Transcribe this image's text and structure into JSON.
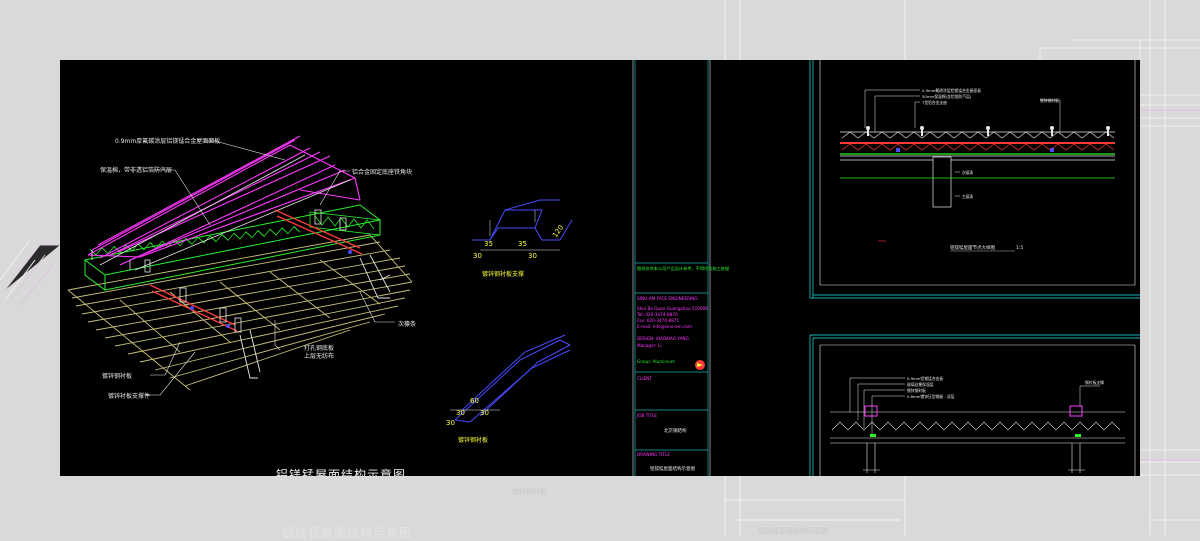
{
  "iso_view": {
    "labels": {
      "panel": "0.9mm厚氟碳涂层铝镁锰合金屋面面板",
      "insulation": "保温棉，带非透铝箔防汽层",
      "bracket": "铝合金固定底座铁角块",
      "purlin": "次檩条",
      "ribbed": "打孔钢底板",
      "upper_layer": "上层无纺布",
      "galv": "镀锌钢衬板",
      "galv_support": "镀锌衬板支撑件"
    },
    "caption": "铝镁锰屋面结构示意图"
  },
  "profile_a": {
    "label": "镀锌钢衬板支撑",
    "dims": [
      "35",
      "35",
      "30",
      "30",
      "120"
    ]
  },
  "profile_b": {
    "label": "镀锌钢衬板",
    "dims": [
      "60",
      "30",
      "30",
      "30"
    ]
  },
  "title_block": {
    "note_top": "图纸仅供本公司产品设计参考，不得作为施工依据",
    "company_en": "SINO-AM FACE ENGINEERING",
    "addr_lines": [
      "Shui Ba Quan Guangzhou 510006",
      "Tel: 020-3474-8870",
      "Fax: 020-3474-8871",
      "E-mail: info@sino-am.com"
    ],
    "mgr_lines": [
      "DESIGN: XIAOXIAO YANG",
      "Manager: Li"
    ],
    "group_name": "Group: Aluminium",
    "client_label": "CLIENT",
    "job_title_label": "JOB TITLE",
    "job_title_value": "北京钢结构",
    "drawing_title_label": "DRAWING TITLE",
    "drawing_title_value": "铝镁锰屋面结构示意图"
  },
  "section_top": {
    "caption": "铝镁锰屋面节点大样图",
    "scale": "1:5",
    "callouts": [
      "0.9mm氟碳涂层铝镁锰合金屋面板",
      "50mm保温棉(含铝箔防汽层)",
      "T型铝合金支座",
      "镀锌钢衬板",
      "次檩条",
      "主檩条"
    ]
  },
  "section_bottom": {
    "callouts": [
      "0.9mm铝镁锰合金板",
      "玻璃丝棉保温层",
      "镀锌钢衬板",
      "钢衬板支撑",
      "0.6mm镀锌压型钢板 - 双层"
    ]
  },
  "ghost": {
    "caption_left": "铝镁锰屋面结构示意图",
    "caption_mid": "镀锌钢衬板",
    "caption_right": "铝镁锰屋面结构示意图"
  },
  "colors": {
    "canvas": "#000000",
    "magenta": "#ff38ff",
    "green": "#29f229",
    "yellow": "#ffff3a",
    "cyan": "#19b3b3",
    "red": "#ff3a3a",
    "blue": "#4a4aff"
  }
}
